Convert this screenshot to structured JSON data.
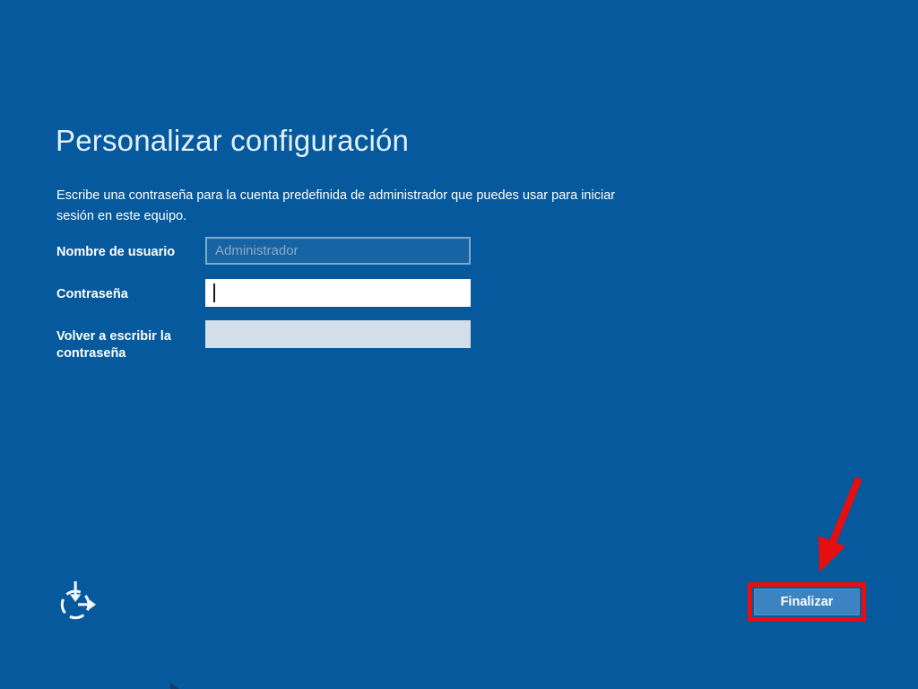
{
  "window": {
    "kind": "windows-setup-oobe-screen",
    "language": "es"
  },
  "header": {
    "title": "Personalizar configuración",
    "description_lines": [
      "Escribe una contraseña para la cuenta predefinida de administrador que puedes usar para iniciar",
      "sesión en este equipo."
    ]
  },
  "form": {
    "fields": [
      {
        "label": "Nombre de usuario",
        "placeholder": "Administrador",
        "value": "",
        "state": "readonly"
      },
      {
        "label": "Contraseña",
        "placeholder": "",
        "value": "",
        "state": "focused",
        "has_caret": true
      },
      {
        "label": "Volver a escribir la contraseña",
        "placeholder": "",
        "value": "",
        "state": "disabled"
      }
    ]
  },
  "footer": {
    "ease_of_access_icon": "ease-of-access-icon",
    "finish_button_label": "Finalizar"
  },
  "annotation": {
    "type": "red arrow and red box",
    "target": "Finalizar button",
    "color": "#e60e0e"
  },
  "colors": {
    "background": "#05599c",
    "title_text": "#e3f1fc",
    "body_text": "#ffffff",
    "placeholder_text": "#8ba9c6",
    "input_border": "rgba(255,255,255,0.45)",
    "password_field_bg": "#ffffff",
    "disabled_field_bg": "#d3dee9",
    "button_bg": "#3c83c1",
    "annotation_red": "#e60e0e"
  }
}
